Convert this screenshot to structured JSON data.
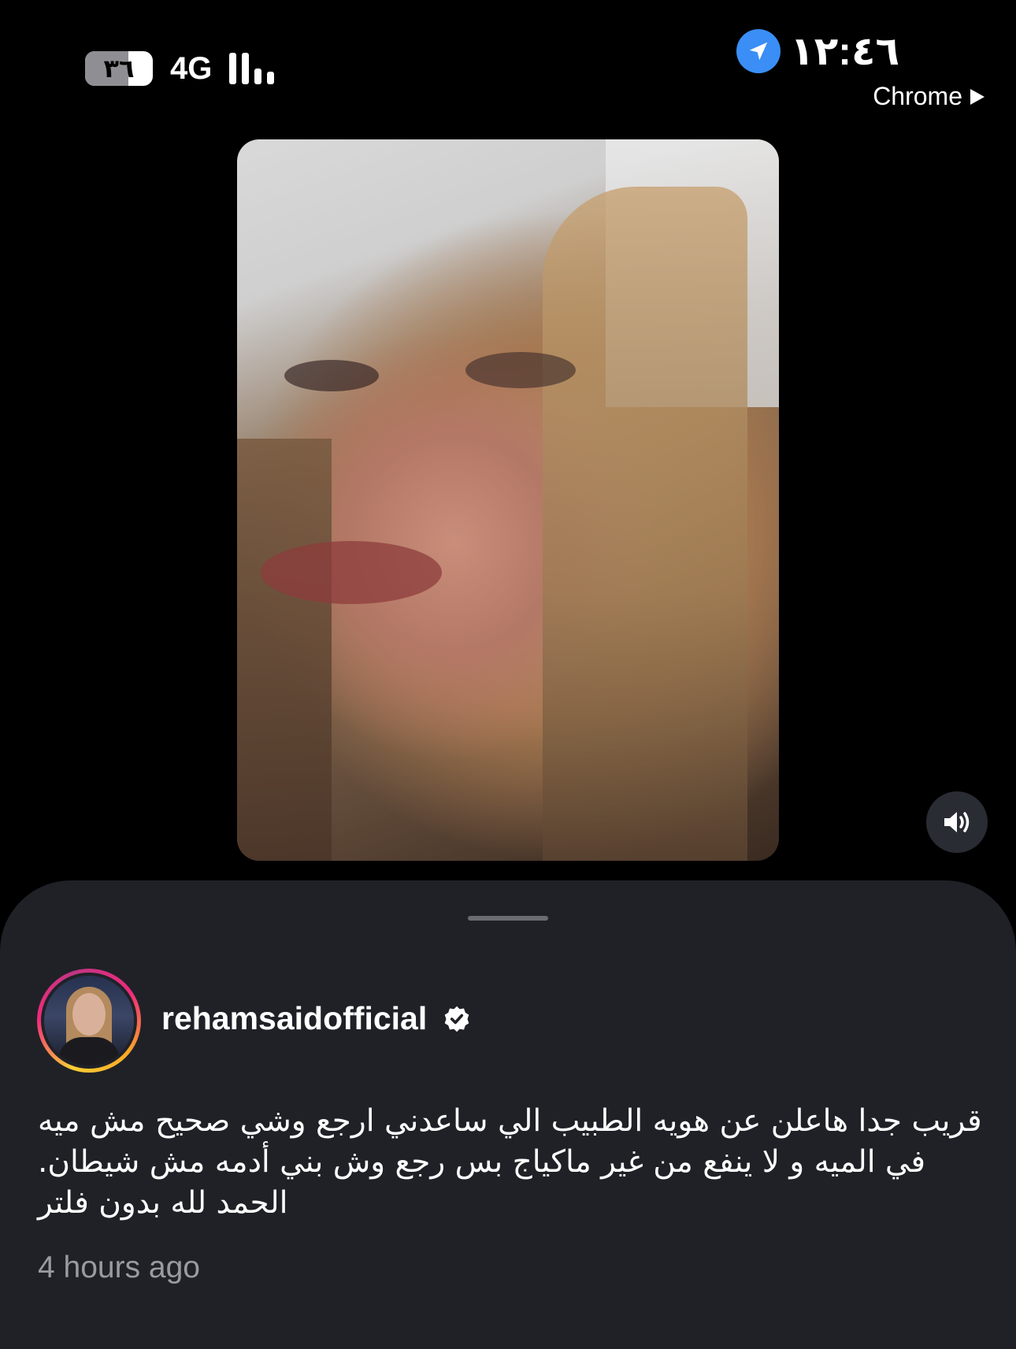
{
  "status_bar": {
    "battery_level": "٣٦",
    "battery_fraction": 0.36,
    "network": "4G",
    "signal_bars": 2,
    "time": "١٢:٤٦",
    "location_icon": "location-arrow-icon",
    "back_app_label": "Chrome",
    "back_icon": "play-triangle-icon"
  },
  "video": {
    "sound_icon": "speaker-on-icon"
  },
  "post": {
    "username": "rehamsaidofficial",
    "verified_icon": "verified-badge-icon",
    "caption": "قريب جدا هاعلن عن هويه الطبيب الي ساعدني ارجع وشي صحيح مش ميه في الميه و لا ينفع من غير ماكياج بس رجع وش بني أدمه مش شيطان. الحمد لله بدون فلتر",
    "time_ago": "4 hours ago"
  },
  "colors": {
    "background": "#000000",
    "sheet": "#202127",
    "accent_location": "#3a8ef6",
    "muted_text": "#9a9ba1"
  }
}
